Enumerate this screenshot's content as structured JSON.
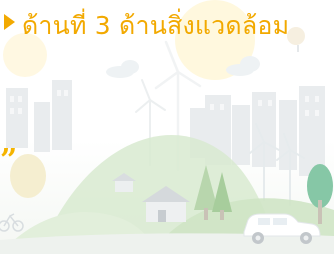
{
  "header": {
    "marker_icon": "play-triangle-icon",
    "title": "ด้านที่ 3 ด้านสิ่งแวดล้อม"
  },
  "decor": {
    "quote_mark": "”"
  },
  "colors": {
    "title": "#f2a900",
    "hill_green": "#cfe6c4",
    "hill_dark": "#a9d29b",
    "building": "#e3e6e8",
    "car": "#ffffff"
  }
}
